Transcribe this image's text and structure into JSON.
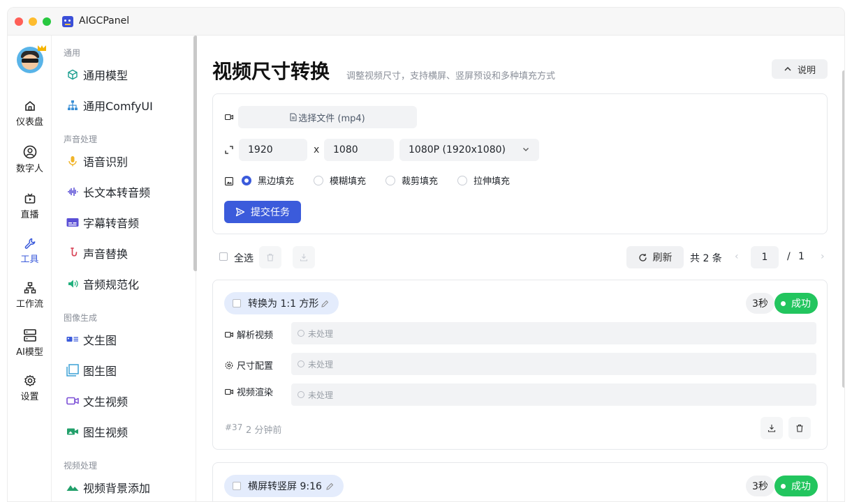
{
  "app": {
    "title": "AIGCPanel"
  },
  "rail": [
    {
      "label": "仪表盘",
      "icon": "home-icon"
    },
    {
      "label": "数字人",
      "icon": "user-circle-icon"
    },
    {
      "label": "直播",
      "icon": "tv-icon"
    },
    {
      "label": "工具",
      "icon": "wrench-icon",
      "active": true
    },
    {
      "label": "工作流",
      "icon": "workflow-icon"
    },
    {
      "label": "AI模型",
      "icon": "server-icon"
    },
    {
      "label": "设置",
      "icon": "gear-icon"
    }
  ],
  "sidebar": {
    "groups": [
      {
        "title": "通用",
        "items": [
          "通用模型",
          "通用ComfyUI"
        ]
      },
      {
        "title": "声音处理",
        "items": [
          "语音识别",
          "长文本转音频",
          "字幕转音频",
          "声音替换",
          "音频规范化"
        ]
      },
      {
        "title": "图像生成",
        "items": [
          "文生图",
          "图生图",
          "文生视频",
          "图生视频"
        ]
      },
      {
        "title": "视频处理",
        "items": [
          "视频背景添加"
        ]
      }
    ]
  },
  "page": {
    "title": "视频尺寸转换",
    "subtitle": "调整视频尺寸，支持横屏、竖屏预设和多种填充方式",
    "help_label": "说明"
  },
  "form": {
    "file_label": "选择文件 (mp4)",
    "width": "1920",
    "times": "x",
    "height": "1080",
    "preset": "1080P (1920x1080)",
    "fill_options": [
      "黑边填充",
      "模糊填充",
      "裁剪填充",
      "拉伸填充"
    ],
    "fill_selected": "黑边填充",
    "submit_label": "提交任务"
  },
  "toolbar": {
    "select_all": "全选",
    "refresh": "刷新",
    "total": "共 2 条",
    "page": "1",
    "page_sep": "/",
    "page_total": "1"
  },
  "tasks": [
    {
      "title": "转换为 1:1 方形",
      "duration": "3秒",
      "status": "成功",
      "steps": [
        {
          "label": "解析视频",
          "value": "未处理"
        },
        {
          "label": "尺寸配置",
          "value": "未处理"
        },
        {
          "label": "视频渲染",
          "value": "未处理"
        }
      ],
      "id": "#37",
      "time": "2 分钟前"
    },
    {
      "title": "横屏转竖屏 9:16",
      "duration": "3秒",
      "status": "成功"
    }
  ],
  "colors": {
    "accent": "#3b5bdb",
    "success": "#22c55e"
  }
}
